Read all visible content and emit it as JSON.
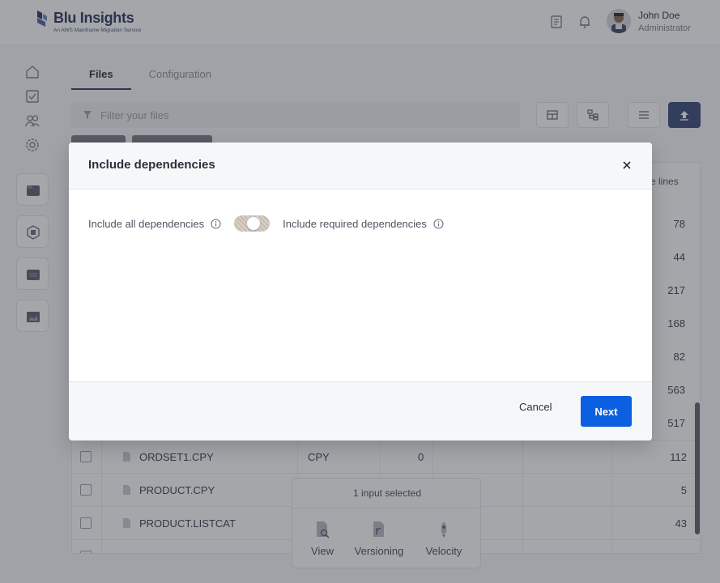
{
  "app": {
    "title": "Blu Insights",
    "subtitle": "An AWS Mainframe Migration Service"
  },
  "user": {
    "name": "John Doe",
    "role": "Administrator"
  },
  "icons": {
    "topbar": [
      "notes-icon",
      "bell-icon"
    ],
    "sidebar": [
      "home-icon",
      "checklist-icon",
      "users-icon",
      "settings-icon",
      "codebase-icon",
      "transformation-icon",
      "documents-icon",
      "gallery-icon"
    ],
    "toolbar": [
      "table-view-icon",
      "tree-view-icon",
      "filter-settings-icon",
      "upload-icon"
    ]
  },
  "tabs": [
    {
      "label": "Files",
      "active": true
    },
    {
      "label": "Configuration",
      "active": false
    }
  ],
  "filter": {
    "placeholder": "Filter your files"
  },
  "table": {
    "column_lines_partial": "ve lines",
    "hidden_numbers": [
      "78",
      "44",
      "217",
      "168",
      "82",
      "563",
      "517"
    ],
    "rows": [
      {
        "name": "ORDSET1.CPY",
        "type": "CPY",
        "count": "0",
        "lines": "112"
      },
      {
        "name": "PRODUCT.CPY",
        "type": "",
        "count": "",
        "lines": "5"
      },
      {
        "name": "PRODUCT.LISTCAT",
        "type": "",
        "count": "",
        "lines": "43"
      }
    ]
  },
  "action_panel": {
    "title": "1 input selected",
    "items": [
      {
        "label": "View",
        "icon": "view-icon"
      },
      {
        "label": "Versioning",
        "icon": "versioning-icon"
      },
      {
        "label": "Velocity",
        "icon": "velocity-icon"
      }
    ]
  },
  "modal": {
    "title": "Include dependencies",
    "option_all": "Include all dependencies",
    "option_required": "Include required dependencies",
    "cancel_label": "Cancel",
    "next_label": "Next"
  },
  "colors": {
    "primary_button": "#0b5fe0",
    "brand_dark": "#2a3a5f",
    "upload_button": "#3c4c7a"
  }
}
